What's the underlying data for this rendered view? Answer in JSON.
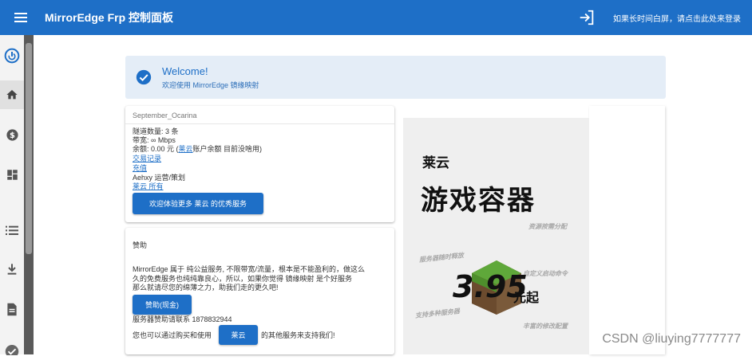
{
  "header": {
    "title": "MirrorEdge Frp 控制面板",
    "login_hint": "如果长时间白屏，请点击此处来登录",
    "menu_icon": "hamburger-icon",
    "login_icon": "login-icon"
  },
  "sidebar": {
    "items": [
      {
        "name": "power-icon"
      },
      {
        "name": "home-icon",
        "active": true
      },
      {
        "name": "dollar-icon"
      },
      {
        "name": "dashboard-icon"
      },
      {
        "name": "list-icon"
      },
      {
        "name": "download-icon"
      },
      {
        "name": "document-icon"
      },
      {
        "name": "check-icon"
      }
    ]
  },
  "welcome": {
    "title": "Welcome!",
    "subtitle": "欢迎使用 MirrorEdge 镜缘映射"
  },
  "user": {
    "name": "September_Ocarina",
    "tunnels": "隧道数量: 3 条",
    "bandwidth": "带宽: ∞ Mbps",
    "balance_prefix": "余额: 0.00 元 (",
    "balance_link": "莱云",
    "balance_suffix": "账户余额 目前没啥用)",
    "link_transactions": "交易记录",
    "link_recharge": "充值",
    "operator": "Aehxy 运营/策划",
    "link_laiyun": "莱云 所有",
    "cta_button": "欢迎体验更多 莱云 的优秀服务"
  },
  "sponsor": {
    "title": "赞助",
    "line1": "MirrorEdge 属于 纯公益服务, 不限带宽/流量，根本是不能盈利的，做这么",
    "line2": "久的免费服务也纯纯靠良心，所以，如果你觉得 镜缘映射 是个好服务",
    "line3": "那么就请尽您的绵薄之力，助我们走的更久吧!",
    "donate_button": "赞助(现金)",
    "contact": "服务器赞助请联系 1878832944",
    "support_prefix": "您也可以通过购买和使用",
    "support_button": "莱云",
    "support_suffix": "的其他服务来支持我们!"
  },
  "ad": {
    "brand": "莱云",
    "title": "游戏容器",
    "features": [
      "资源按需分配",
      "服务器随时释放",
      "自定义启动命令",
      "支持多种服务器",
      "丰富的修改配置"
    ],
    "price": "3.95",
    "price_unit": "元起"
  },
  "watermark": "CSDN @liuying7777777",
  "colors": {
    "primary": "#1e6fc7",
    "welcome_bg": "#e4edf7"
  }
}
